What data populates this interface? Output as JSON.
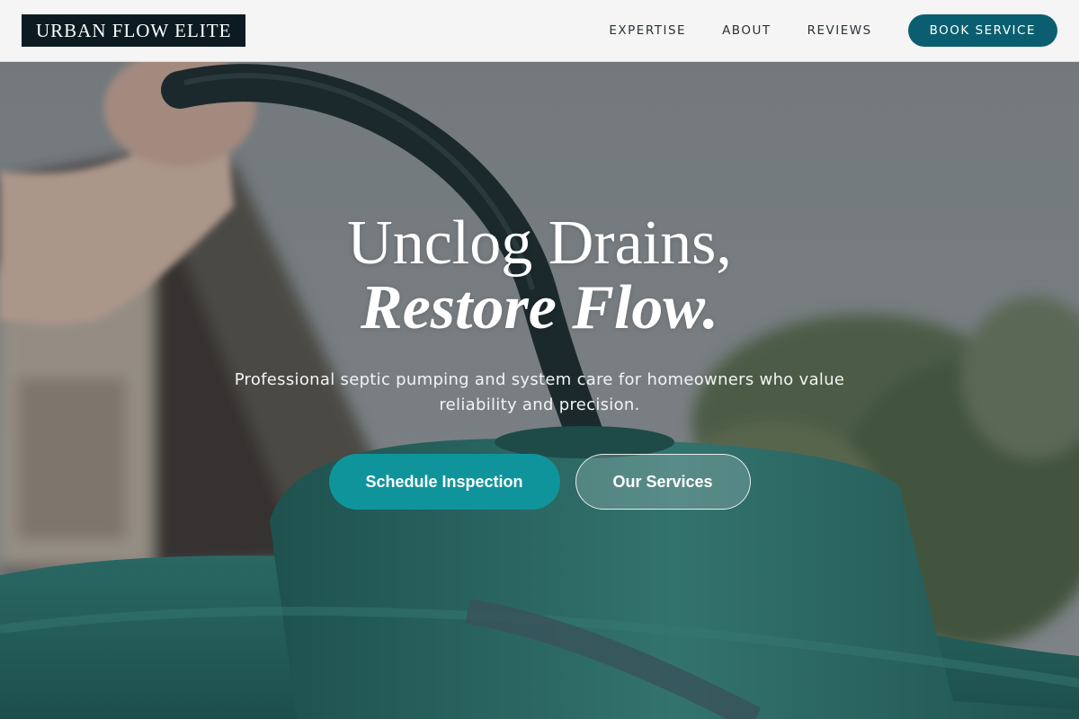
{
  "brand": {
    "name": "URBAN FLOW ELITE"
  },
  "nav": {
    "links": [
      "EXPERTISE",
      "ABOUT",
      "REVIEWS"
    ],
    "cta_label": "BOOK SERVICE"
  },
  "hero": {
    "title_line1": "Unclog Drains,",
    "title_line2": "Restore Flow.",
    "subtitle": "Professional septic pumping and system care for homeowners who value reliability and precision.",
    "primary_cta": "Schedule Inspection",
    "secondary_cta": "Our Services",
    "background_icon": "septic-tank-photo"
  },
  "colors": {
    "header_bg": "#f5f5f5",
    "logo_bg": "#0c1b22",
    "nav_cta_bg": "#0b5e6f",
    "primary_cta_bg": "#0f949c"
  }
}
